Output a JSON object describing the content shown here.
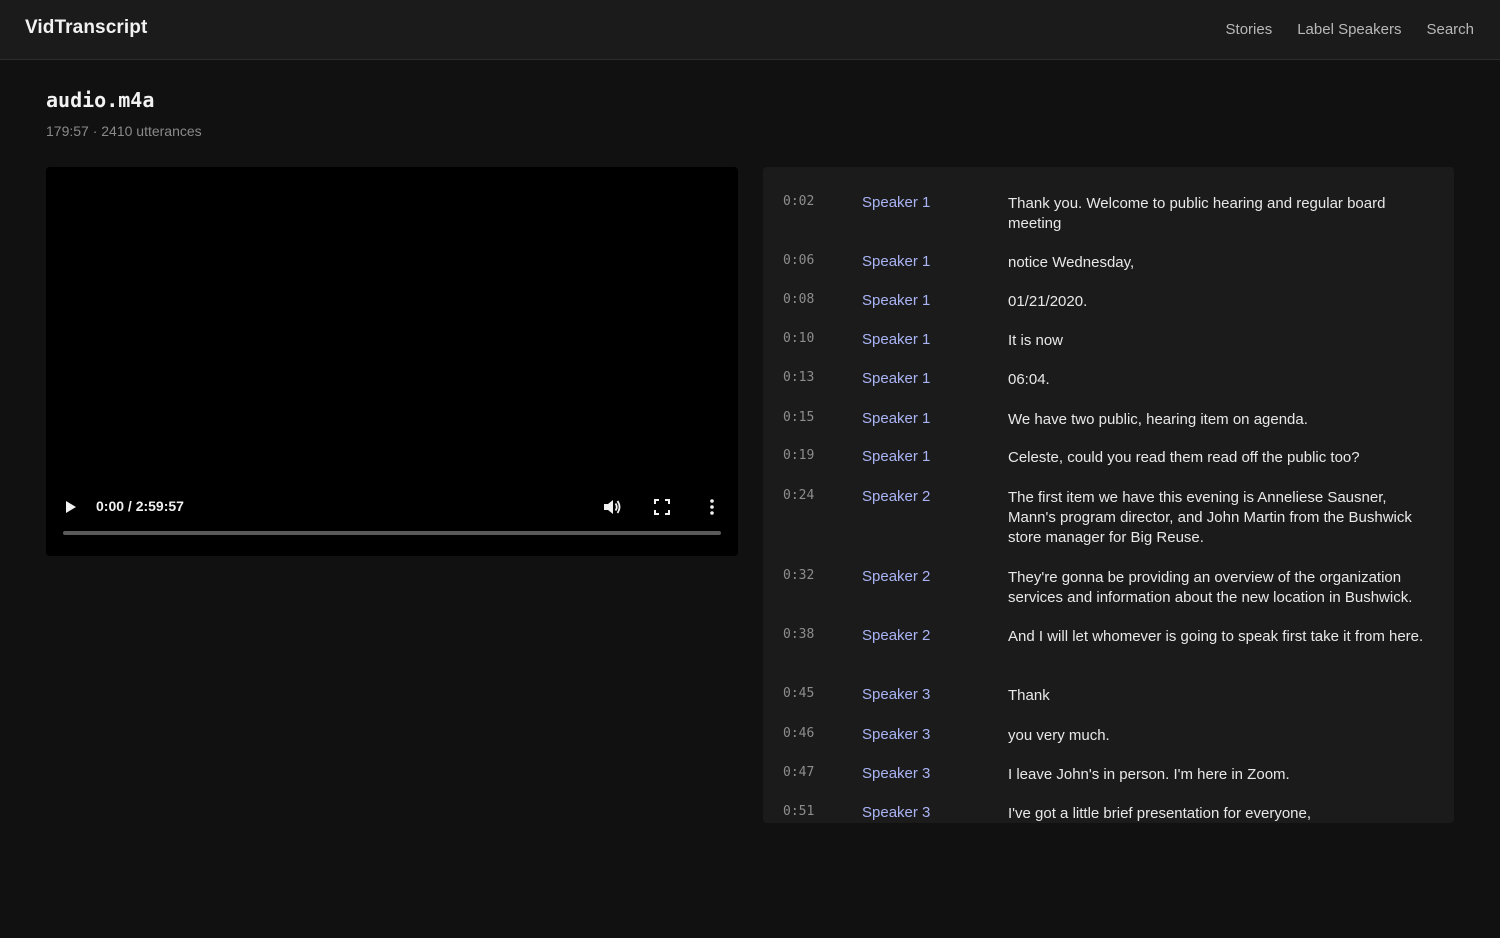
{
  "app": {
    "brand": "VidTranscript",
    "nav": [
      "Stories",
      "Label Speakers",
      "Search"
    ]
  },
  "page": {
    "title": "audio.m4a",
    "meta": "179:57 · 2410 utterances"
  },
  "player": {
    "time": "0:00 / 2:59:57",
    "progress": 0
  },
  "transcript": [
    {
      "time": "0:02",
      "speaker": "Speaker 1",
      "text": "Thank you. Welcome to public hearing and regular board meeting"
    },
    {
      "time": "0:06",
      "speaker": "Speaker 1",
      "text": "notice Wednesday,"
    },
    {
      "time": "0:08",
      "speaker": "Speaker 1",
      "text": "01/21/2020."
    },
    {
      "time": "0:10",
      "speaker": "Speaker 1",
      "text": "It is now"
    },
    {
      "time": "0:13",
      "speaker": "Speaker 1",
      "text": "06:04."
    },
    {
      "time": "0:15",
      "speaker": "Speaker 1",
      "text": "We have two public, hearing item on agenda."
    },
    {
      "time": "0:19",
      "speaker": "Speaker 1",
      "text": "Celeste, could you read them read off the public too?"
    },
    {
      "time": "0:24",
      "speaker": "Speaker 2",
      "text": "The first item we have this evening is Anneliese Sausner, Mann's program director, and John Martin from the Bushwick store manager for Big Reuse."
    },
    {
      "time": "0:32",
      "speaker": "Speaker 2",
      "text": "They're gonna be providing an overview of the organization services and information about the new location in Bushwick."
    },
    {
      "time": "0:38",
      "speaker": "Speaker 2",
      "text": "And I will let whomever is going to speak first take it from here."
    },
    {
      "time": "0:45",
      "speaker": "Speaker 3",
      "text": "Thank"
    },
    {
      "time": "0:46",
      "speaker": "Speaker 3",
      "text": "you very much."
    },
    {
      "time": "0:47",
      "speaker": "Speaker 3",
      "text": "I leave John's in person. I'm here in Zoom."
    },
    {
      "time": "0:51",
      "speaker": "Speaker 3",
      "text": "I've got a little brief presentation for everyone,"
    }
  ]
}
